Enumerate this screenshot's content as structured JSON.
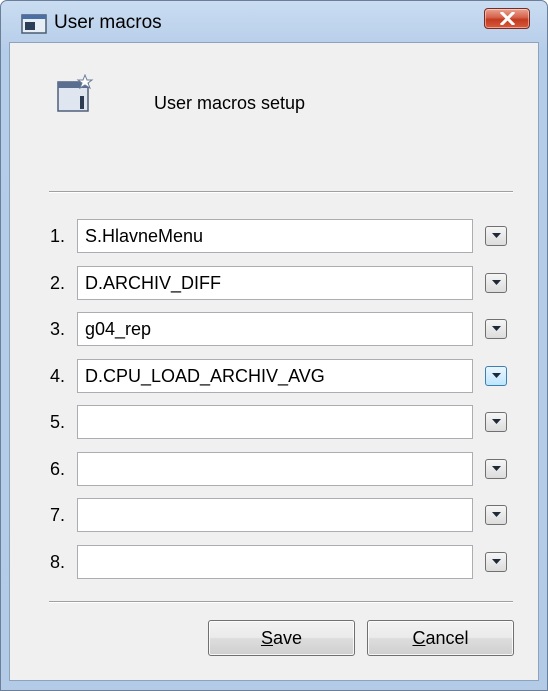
{
  "window": {
    "title": "User macros",
    "close_icon": "close-x-icon"
  },
  "header": {
    "text": "User macros setup",
    "icon": "window-star-icon"
  },
  "macros": [
    {
      "number": "1.",
      "value": "S.HlavneMenu"
    },
    {
      "number": "2.",
      "value": "D.ARCHIV_DIFF"
    },
    {
      "number": "3.",
      "value": "g04_rep"
    },
    {
      "number": "4.",
      "value": "D.CPU_LOAD_ARCHIV_AVG"
    },
    {
      "number": "5.",
      "value": ""
    },
    {
      "number": "6.",
      "value": ""
    },
    {
      "number": "7.",
      "value": ""
    },
    {
      "number": "8.",
      "value": ""
    }
  ],
  "buttons": {
    "save": {
      "accel": "S",
      "rest": "ave"
    },
    "cancel": {
      "accel": "C",
      "rest": "ancel"
    }
  },
  "colors": {
    "close_button": "#c13b1f",
    "hover_button": "#3c7fb1",
    "frame": "#b6cde9"
  }
}
